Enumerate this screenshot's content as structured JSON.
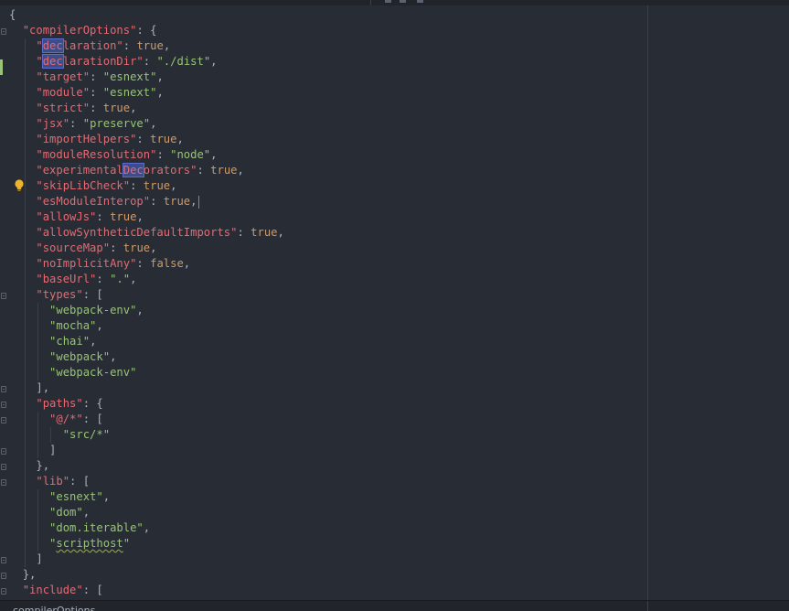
{
  "colors": {
    "background": "#282c34",
    "key": "#e06c75",
    "string": "#98c379",
    "value": "#d19a66",
    "punctuation": "#abb2bf",
    "selection_highlight": "#3e4c8a",
    "change_marker": "#98c379",
    "bulb": "#f0b429"
  },
  "icons": [
    "fold-icon",
    "bulb-icon"
  ],
  "code": {
    "l1": "{",
    "l2k": "\"compilerOptions\"",
    "l2p": ": {",
    "l3ka": "\"",
    "l3kb": "dec",
    "l3kc": "laration\"",
    "l3p": ": ",
    "l3v": "true",
    "l3e": ",",
    "l4ka": "\"",
    "l4kb": "dec",
    "l4kc": "larationDir\"",
    "l4p": ": ",
    "l4s": "\"./dist\"",
    "l4e": ",",
    "l5k": "\"target\"",
    "l5p": ": ",
    "l5s": "\"esnext\"",
    "l5e": ",",
    "l6k": "\"module\"",
    "l6p": ": ",
    "l6s": "\"esnext\"",
    "l6e": ",",
    "l7k": "\"strict\"",
    "l7p": ": ",
    "l7v": "true",
    "l7e": ",",
    "l8k": "\"jsx\"",
    "l8p": ": ",
    "l8s": "\"preserve\"",
    "l8e": ",",
    "l9k": "\"importHelpers\"",
    "l9p": ": ",
    "l9v": "true",
    "l9e": ",",
    "l10k": "\"moduleResolution\"",
    "l10p": ": ",
    "l10s": "\"node\"",
    "l10e": ",",
    "l11ka": "\"experimental",
    "l11kb": "Dec",
    "l11kc": "orators\"",
    "l11p": ": ",
    "l11v": "true",
    "l11e": ",",
    "l12k": "\"skipLibCheck\"",
    "l12p": ": ",
    "l12v": "true",
    "l12e": ",",
    "l13k": "\"esModuleInterop\"",
    "l13p": ": ",
    "l13v": "true",
    "l13e": ",",
    "l14k": "\"allowJs\"",
    "l14p": ": ",
    "l14v": "true",
    "l14e": ",",
    "l15k": "\"allowSyntheticDefaultImports\"",
    "l15p": ": ",
    "l15v": "true",
    "l15e": ",",
    "l16k": "\"sourceMap\"",
    "l16p": ": ",
    "l16v": "true",
    "l16e": ",",
    "l17k": "\"noImplicitAny\"",
    "l17p": ": ",
    "l17v": "false",
    "l17e": ",",
    "l18k": "\"baseUrl\"",
    "l18p": ": ",
    "l18s": "\".\"",
    "l18e": ",",
    "l19k": "\"types\"",
    "l19p": ": [",
    "l20s": "\"webpack-env\"",
    "l20e": ",",
    "l21s": "\"mocha\"",
    "l21e": ",",
    "l22s": "\"chai\"",
    "l22e": ",",
    "l23s": "\"webpack\"",
    "l23e": ",",
    "l24s": "\"webpack-env\"",
    "l25": "],",
    "l26k": "\"paths\"",
    "l26p": ": {",
    "l27k": "\"@/*\"",
    "l27p": ": [",
    "l28s": "\"src/*\"",
    "l29": "]",
    "l30": "},",
    "l31k": "\"lib\"",
    "l31p": ": [",
    "l32s": "\"esnext\"",
    "l32e": ",",
    "l33s": "\"dom\"",
    "l33e": ",",
    "l34s": "\"dom.iterable\"",
    "l34e": ",",
    "l35sa": "\"",
    "l35sb": "scripthost",
    "l35sc": "\"",
    "l36": "]",
    "l37": "},",
    "l38k": "\"include\"",
    "l38p": ": ["
  },
  "status": {
    "breadcrumb": "compilerOptions"
  }
}
